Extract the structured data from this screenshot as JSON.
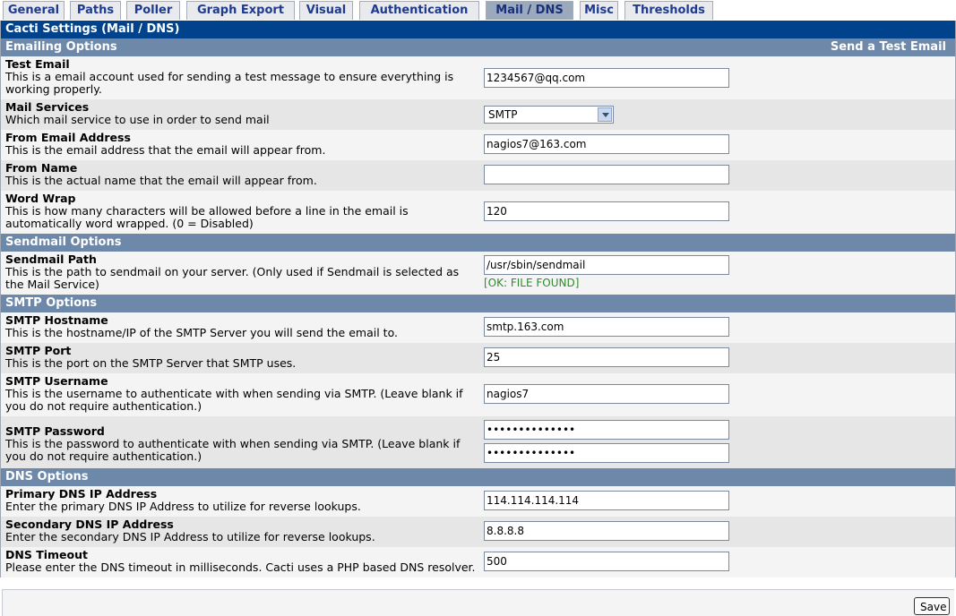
{
  "tabs": [
    {
      "label": "General",
      "active": false
    },
    {
      "label": "Paths",
      "active": false
    },
    {
      "label": "Poller",
      "active": false
    },
    {
      "label": "Graph Export",
      "active": false
    },
    {
      "label": "Visual",
      "active": false
    },
    {
      "label": "Authentication",
      "active": false
    },
    {
      "label": "Mail / DNS",
      "active": true
    },
    {
      "label": "Misc",
      "active": false
    },
    {
      "label": "Thresholds",
      "active": false
    }
  ],
  "page_title": "Cacti Settings (Mail / DNS)",
  "sections": {
    "emailing": {
      "title": "Emailing Options",
      "send_test_link": "Send a Test Email"
    },
    "sendmail": {
      "title": "Sendmail Options"
    },
    "smtp": {
      "title": "SMTP Options"
    },
    "dns": {
      "title": "DNS Options"
    }
  },
  "fields": {
    "test_email": {
      "name": "Test Email",
      "desc": "This is a email account used for sending a test message to ensure everything is working properly.",
      "value": "1234567@qq.com"
    },
    "mail_services": {
      "name": "Mail Services",
      "desc": "Which mail service to use in order to send mail",
      "value": "SMTP"
    },
    "from_email": {
      "name": "From Email Address",
      "desc": "This is the email address that the email will appear from.",
      "value": "nagios7@163.com"
    },
    "from_name": {
      "name": "From Name",
      "desc": "This is the actual name that the email will appear from.",
      "value": ""
    },
    "word_wrap": {
      "name": "Word Wrap",
      "desc": "This is how many characters will be allowed before a line in the email is automatically word wrapped. (0 = Disabled)",
      "value": "120"
    },
    "sendmail_path": {
      "name": "Sendmail Path",
      "desc": "This is the path to sendmail on your server. (Only used if Sendmail is selected as the Mail Service)",
      "value": "/usr/sbin/sendmail",
      "status": "[OK: FILE FOUND]"
    },
    "smtp_hostname": {
      "name": "SMTP Hostname",
      "desc": "This is the hostname/IP of the SMTP Server you will send the email to.",
      "value": "smtp.163.com"
    },
    "smtp_port": {
      "name": "SMTP Port",
      "desc": "This is the port on the SMTP Server that SMTP uses.",
      "value": "25"
    },
    "smtp_username": {
      "name": "SMTP Username",
      "desc": "This is the username to authenticate with when sending via SMTP. (Leave blank if you do not require authentication.)",
      "value": "nagios7"
    },
    "smtp_password": {
      "name": "SMTP Password",
      "desc": "This is the password to authenticate with when sending via SMTP. (Leave blank if you do not require authentication.)",
      "value": "••••••••••••••",
      "confirm_value": "••••••••••••••"
    },
    "primary_dns": {
      "name": "Primary DNS IP Address",
      "desc": "Enter the primary DNS IP Address to utilize for reverse lookups.",
      "value": "114.114.114.114"
    },
    "secondary_dns": {
      "name": "Secondary DNS IP Address",
      "desc": "Enter the secondary DNS IP Address to utilize for reverse lookups.",
      "value": "8.8.8.8"
    },
    "dns_timeout": {
      "name": "DNS Timeout",
      "desc": "Please enter the DNS timeout in milliseconds. Cacti uses a PHP based DNS resolver.",
      "value": "500"
    }
  },
  "footer": {
    "save_label": "Save"
  },
  "colors": {
    "title_bar": "#00438c",
    "section_header": "#6d88a8",
    "tab_text": "#1f3a8f",
    "ok_status": "#2f8a2f"
  }
}
